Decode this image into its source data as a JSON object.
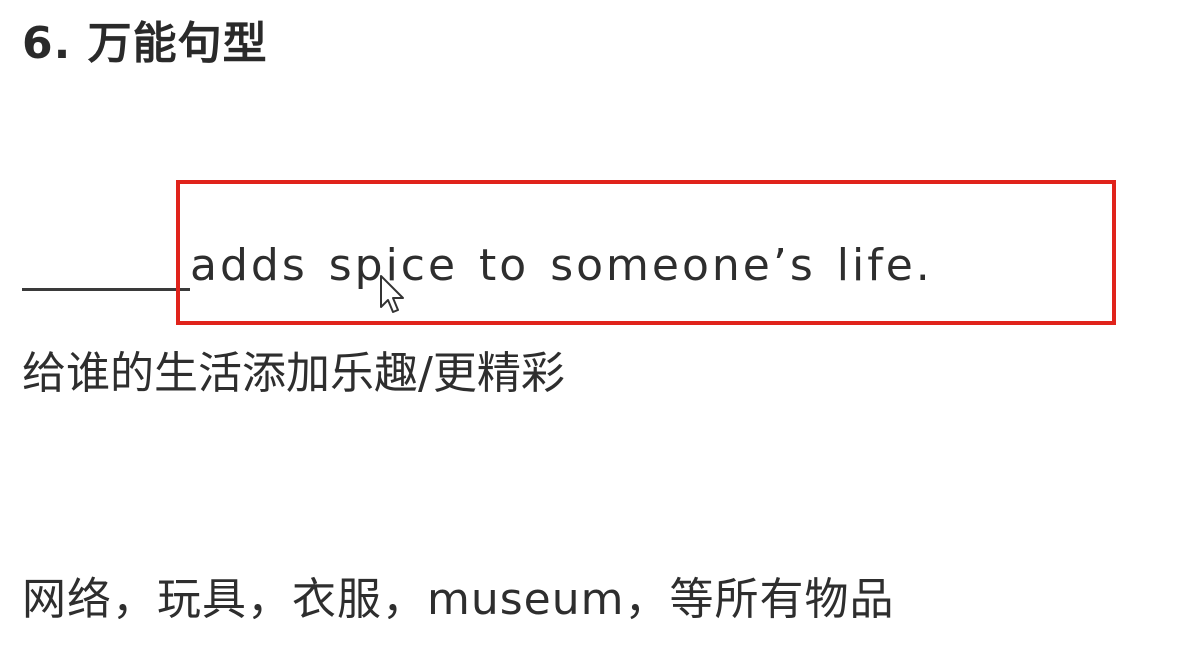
{
  "heading": "6. 万能句型",
  "pattern": {
    "sentence": "adds spice to someone’s life."
  },
  "meaning": "给谁的生活添加乐趣/更精彩",
  "usage": "网络，玩具，衣服，museum，等所有物品",
  "colors": {
    "highlight_border": "#e0231b",
    "text": "#2e2e2e"
  },
  "icons": {
    "cursor": "mouse-pointer-icon"
  }
}
